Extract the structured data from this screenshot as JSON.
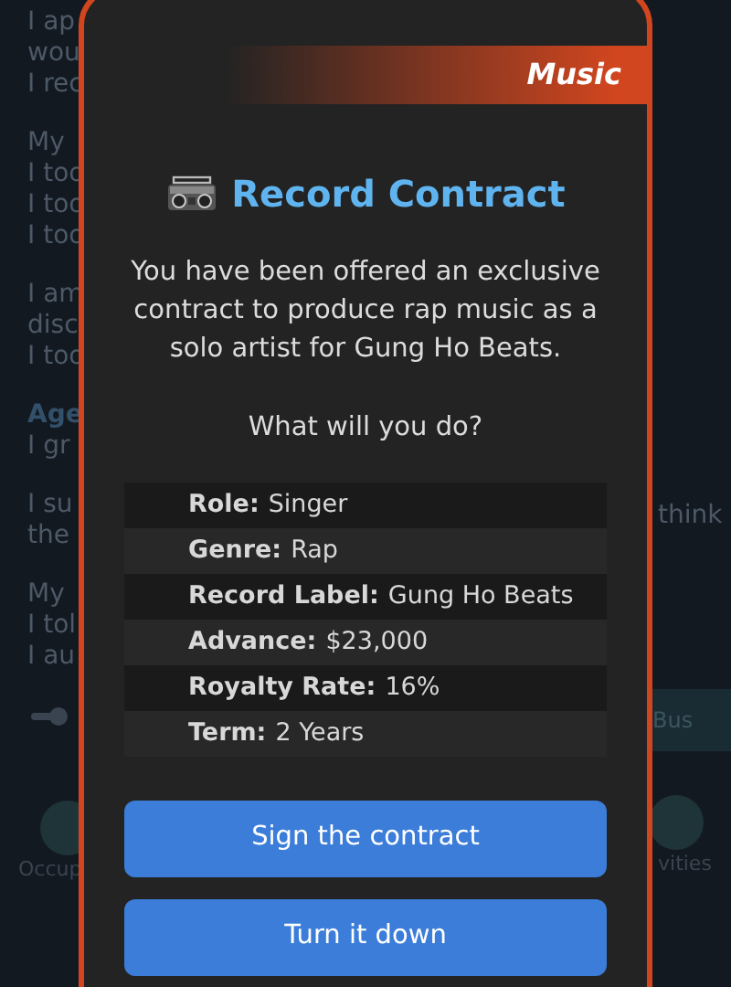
{
  "background": {
    "paragraphs": [
      {
        "lines": [
          {
            "text": "I ap",
            "kind": "text"
          },
          {
            "text": "wou",
            "kind": "text"
          },
          {
            "text": "I rec",
            "kind": "text"
          }
        ]
      },
      {
        "lines": [
          {
            "text": "My",
            "kind": "text"
          },
          {
            "text": "I too",
            "kind": "text"
          },
          {
            "text": "I too",
            "kind": "text"
          },
          {
            "text": "I too",
            "kind": "text"
          }
        ]
      },
      {
        "lines": [
          {
            "text": "I am",
            "kind": "text"
          },
          {
            "text": "disc",
            "kind": "text"
          },
          {
            "text": "I too",
            "kind": "text"
          }
        ]
      },
      {
        "lines": [
          {
            "text": "Age",
            "kind": "heading"
          },
          {
            "text": "I gr",
            "kind": "text"
          }
        ]
      },
      {
        "lines": [
          {
            "text": "I su",
            "kind": "text"
          },
          {
            "text": "the",
            "kind": "text"
          }
        ]
      },
      {
        "lines": [
          {
            "text": "My",
            "kind": "text"
          },
          {
            "text": "I tol",
            "kind": "text"
          },
          {
            "text": "I au",
            "kind": "text"
          }
        ]
      }
    ],
    "right_fragment": "think",
    "right_button": "Bus",
    "left_tile": "Occup",
    "right_tile": "vities"
  },
  "modal": {
    "category": "Music",
    "title": "Record Contract",
    "message": "You have been offered an exclusive contract to produce rap music as a solo artist for Gung Ho Beats.",
    "question": "What will you do?",
    "details": [
      {
        "label": "Role:",
        "value": "Singer"
      },
      {
        "label": "Genre:",
        "value": "Rap"
      },
      {
        "label": "Record Label:",
        "value": "Gung Ho Beats"
      },
      {
        "label": "Advance:",
        "value": "$23,000"
      },
      {
        "label": "Royalty Rate:",
        "value": "16%"
      },
      {
        "label": "Term:",
        "value": "2 Years"
      }
    ],
    "buttons": [
      "Sign the contract",
      "Turn it down"
    ]
  }
}
